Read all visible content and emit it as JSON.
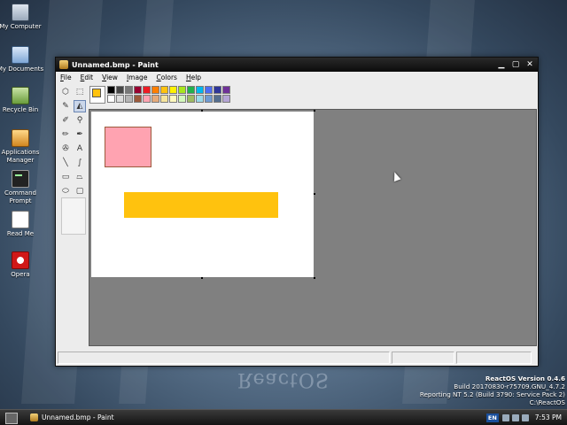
{
  "desktop": {
    "icons": [
      {
        "label": "My Computer",
        "icon": "computer-icon"
      },
      {
        "label": "My Documents",
        "icon": "documents-folder-icon"
      },
      {
        "label": "Recycle Bin",
        "icon": "recycle-bin-icon"
      },
      {
        "label": "Applications Manager",
        "icon": "applications-manager-icon"
      },
      {
        "label": "Command Prompt",
        "icon": "command-prompt-icon"
      },
      {
        "label": "Read Me",
        "icon": "text-document-icon"
      },
      {
        "label": "Opera",
        "icon": "opera-browser-icon"
      }
    ],
    "version_info": {
      "line1": "ReactOS Version 0.4.6",
      "line2": "Build 20170830-r75709.GNU_4.7.2",
      "line3": "Reporting NT 5.2 (Build 3790: Service Pack 2)",
      "line4": "C:\\ReactOS"
    }
  },
  "window": {
    "title": "Unnamed.bmp - Paint",
    "menu": [
      {
        "accel": "F",
        "rest": "ile"
      },
      {
        "accel": "E",
        "rest": "dit"
      },
      {
        "accel": "V",
        "rest": "iew"
      },
      {
        "accel": "I",
        "rest": "mage"
      },
      {
        "accel": "C",
        "rest": "olors"
      },
      {
        "accel": "H",
        "rest": "elp"
      }
    ],
    "tools": [
      {
        "icon": "free-select-icon",
        "glyph": "⬡",
        "selected": false
      },
      {
        "icon": "rect-select-icon",
        "glyph": "⬚",
        "selected": false
      },
      {
        "icon": "eraser-icon",
        "glyph": "✎",
        "selected": false
      },
      {
        "icon": "fill-bucket-icon",
        "glyph": "◭",
        "selected": true
      },
      {
        "icon": "color-picker-icon",
        "glyph": "✐",
        "selected": false
      },
      {
        "icon": "magnifier-icon",
        "glyph": "⚲",
        "selected": false
      },
      {
        "icon": "pencil-icon",
        "glyph": "✏",
        "selected": false
      },
      {
        "icon": "brush-icon",
        "glyph": "✒",
        "selected": false
      },
      {
        "icon": "airbrush-icon",
        "glyph": "✇",
        "selected": false
      },
      {
        "icon": "text-icon",
        "glyph": "A",
        "selected": false
      },
      {
        "icon": "line-icon",
        "glyph": "╲",
        "selected": false
      },
      {
        "icon": "curve-icon",
        "glyph": "∫",
        "selected": false
      },
      {
        "icon": "rectangle-icon",
        "glyph": "▭",
        "selected": false
      },
      {
        "icon": "polygon-icon",
        "glyph": "⏢",
        "selected": false
      },
      {
        "icon": "ellipse-icon",
        "glyph": "⬭",
        "selected": false
      },
      {
        "icon": "rounded-rect-icon",
        "glyph": "▢",
        "selected": false
      }
    ],
    "palette": {
      "foreground": "#ffc20e",
      "background": "#ffffff",
      "row1": [
        "#000000",
        "#464646",
        "#787878",
        "#990030",
        "#ed1c24",
        "#ff7e00",
        "#ffc20e",
        "#fff200",
        "#a8e61d",
        "#22b14c",
        "#00b7ef",
        "#4d6df3",
        "#2f3699",
        "#6f3198"
      ],
      "row2": [
        "#ffffff",
        "#dcdcdc",
        "#b4b4b4",
        "#9c5a3c",
        "#ffa3b1",
        "#e5aa7a",
        "#f5e49c",
        "#fff9bd",
        "#d3f9bc",
        "#9dbb61",
        "#99d9ea",
        "#709ad1",
        "#546d8e",
        "#b5a5d5"
      ]
    },
    "canvas": {
      "background": "#ffffff",
      "pink_rect_color": "#ffa3b1",
      "pink_rect_border": "#9c5a3c",
      "yellow_rect_color": "#ffc20e"
    },
    "statusbar": [
      "",
      "",
      ""
    ]
  },
  "taskbar": {
    "task_label": "Unnamed.bmp - Paint",
    "language": "EN",
    "time": "7:53 PM"
  }
}
